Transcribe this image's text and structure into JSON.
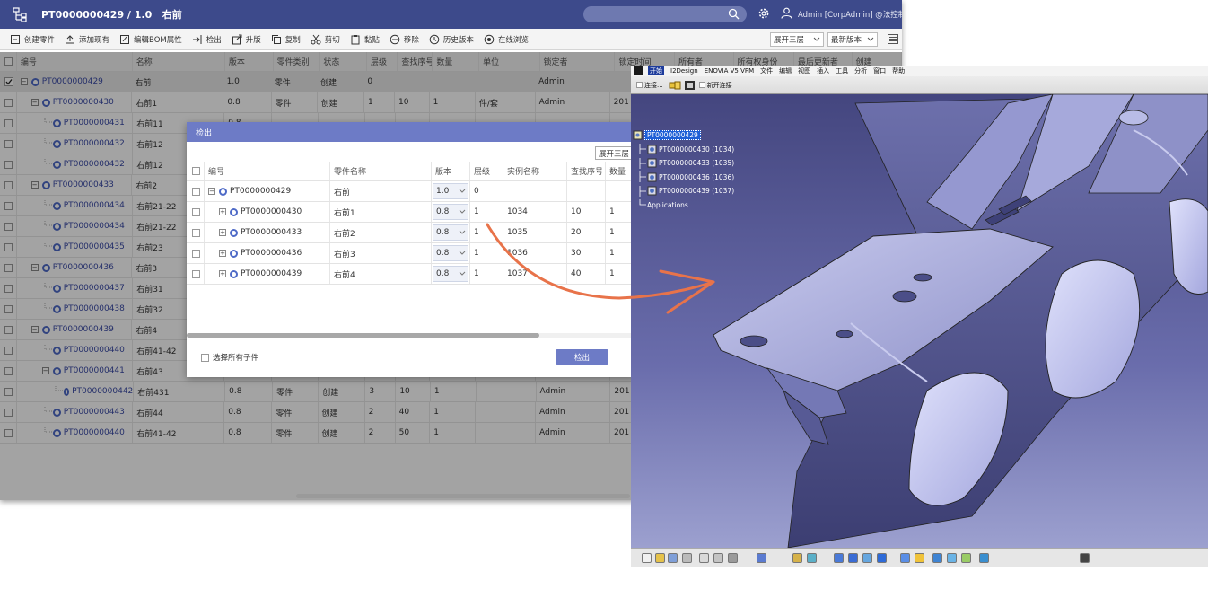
{
  "plm": {
    "title": "PT0000000429 / 1.0",
    "title_suffix": "右前",
    "user": "Admin [CorpAdmin] @法控制",
    "toolbar": [
      {
        "label": "创建零件",
        "icon": "create-part-icon"
      },
      {
        "label": "添加现有",
        "icon": "add-existing-icon"
      },
      {
        "label": "编辑BOM属性",
        "icon": "edit-bom-icon"
      },
      {
        "label": "检出",
        "icon": "checkout-icon"
      },
      {
        "label": "升版",
        "icon": "revise-icon"
      },
      {
        "label": "复制",
        "icon": "copy-icon"
      },
      {
        "label": "剪切",
        "icon": "cut-icon"
      },
      {
        "label": "黏贴",
        "icon": "paste-icon"
      },
      {
        "label": "移除",
        "icon": "remove-icon"
      },
      {
        "label": "历史版本",
        "icon": "history-icon"
      },
      {
        "label": "在线浏览",
        "icon": "online-view-icon"
      }
    ],
    "level_select": "展开三层",
    "version_select": "最新版本",
    "columns": [
      "编号",
      "名称",
      "版本",
      "零件类别",
      "状态",
      "层级",
      "查找序号",
      "数量",
      "单位",
      "锁定者",
      "锁定时间",
      "所有者",
      "所有权身份",
      "最后更新者",
      "创建"
    ],
    "rows": [
      {
        "code": "PT0000000429",
        "name": "右前",
        "version": "1.0",
        "category": "零件",
        "status": "创建",
        "level": "0",
        "find": "",
        "qty": "",
        "unit": "",
        "locker": "Admin",
        "locktime": "",
        "selected": true
      },
      {
        "code": "PT0000000430",
        "name": "右前1",
        "version": "0.8",
        "category": "零件",
        "status": "创建",
        "level": "1",
        "find": "10",
        "qty": "1",
        "unit": "件/套",
        "locker": "Admin",
        "locktime": "201"
      },
      {
        "code": "PT0000000431",
        "name": "右前11",
        "version": "0.8",
        "category": "",
        "status": "",
        "level": "",
        "find": "",
        "qty": "",
        "unit": "",
        "locker": "",
        "locktime": ""
      },
      {
        "code": "PT0000000432",
        "name": "右前12",
        "version": "",
        "category": "",
        "status": "",
        "level": "",
        "find": "",
        "qty": "",
        "unit": "",
        "locker": "",
        "locktime": ""
      },
      {
        "code": "PT0000000432",
        "name": "右前12",
        "version": "",
        "category": "",
        "status": "",
        "level": "",
        "find": "",
        "qty": "",
        "unit": "",
        "locker": "",
        "locktime": ""
      },
      {
        "code": "PT0000000433",
        "name": "右前2",
        "version": "",
        "category": "",
        "status": "",
        "level": "",
        "find": "",
        "qty": "",
        "unit": "",
        "locker": "",
        "locktime": ""
      },
      {
        "code": "PT0000000434",
        "name": "右前21-22",
        "version": "",
        "category": "",
        "status": "",
        "level": "",
        "find": "",
        "qty": "",
        "unit": "",
        "locker": "",
        "locktime": ""
      },
      {
        "code": "PT0000000434",
        "name": "右前21-22",
        "version": "",
        "category": "",
        "status": "",
        "level": "",
        "find": "",
        "qty": "",
        "unit": "",
        "locker": "",
        "locktime": ""
      },
      {
        "code": "PT0000000435",
        "name": "右前23",
        "version": "",
        "category": "",
        "status": "",
        "level": "",
        "find": "",
        "qty": "",
        "unit": "",
        "locker": "",
        "locktime": ""
      },
      {
        "code": "PT0000000436",
        "name": "右前3",
        "version": "",
        "category": "",
        "status": "",
        "level": "",
        "find": "",
        "qty": "",
        "unit": "",
        "locker": "",
        "locktime": ""
      },
      {
        "code": "PT0000000437",
        "name": "右前31",
        "version": "",
        "category": "",
        "status": "",
        "level": "",
        "find": "",
        "qty": "",
        "unit": "",
        "locker": "",
        "locktime": ""
      },
      {
        "code": "PT0000000438",
        "name": "右前32",
        "version": "",
        "category": "",
        "status": "",
        "level": "",
        "find": "",
        "qty": "",
        "unit": "",
        "locker": "",
        "locktime": ""
      },
      {
        "code": "PT0000000439",
        "name": "右前4",
        "version": "",
        "category": "",
        "status": "",
        "level": "",
        "find": "",
        "qty": "",
        "unit": "",
        "locker": "",
        "locktime": ""
      },
      {
        "code": "PT0000000440",
        "name": "右前41-42",
        "version": "",
        "category": "",
        "status": "",
        "level": "",
        "find": "",
        "qty": "",
        "unit": "",
        "locker": "",
        "locktime": ""
      },
      {
        "code": "PT0000000441",
        "name": "右前43",
        "version": "",
        "category": "",
        "status": "",
        "level": "",
        "find": "",
        "qty": "",
        "unit": "",
        "locker": "",
        "locktime": ""
      },
      {
        "code": "PT0000000442",
        "name": "右前431",
        "version": "0.8",
        "category": "零件",
        "status": "创建",
        "level": "3",
        "find": "10",
        "qty": "1",
        "unit": "",
        "locker": "Admin",
        "locktime": "201"
      },
      {
        "code": "PT0000000443",
        "name": "右前44",
        "version": "0.8",
        "category": "零件",
        "status": "创建",
        "level": "2",
        "find": "40",
        "qty": "1",
        "unit": "",
        "locker": "Admin",
        "locktime": "201"
      },
      {
        "code": "PT0000000440",
        "name": "右前41-42",
        "version": "0.8",
        "category": "零件",
        "status": "创建",
        "level": "2",
        "find": "50",
        "qty": "1",
        "unit": "",
        "locker": "Admin",
        "locktime": "201"
      }
    ]
  },
  "dialog": {
    "title": "检出",
    "expand_label": "展开三层",
    "columns": [
      "编号",
      "零件名称",
      "版本",
      "层级",
      "实例名称",
      "查找序号",
      "数量"
    ],
    "rows": [
      {
        "code": "PT0000000429",
        "name": "右前",
        "version": "1.0",
        "level": "0",
        "instance": "",
        "find": "",
        "qty": ""
      },
      {
        "code": "PT0000000430",
        "name": "右前1",
        "version": "0.8",
        "level": "1",
        "instance": "1034",
        "find": "10",
        "qty": "1"
      },
      {
        "code": "PT0000000433",
        "name": "右前2",
        "version": "0.8",
        "level": "1",
        "instance": "1035",
        "find": "20",
        "qty": "1"
      },
      {
        "code": "PT0000000436",
        "name": "右前3",
        "version": "0.8",
        "level": "1",
        "instance": "1036",
        "find": "30",
        "qty": "1"
      },
      {
        "code": "PT0000000439",
        "name": "右前4",
        "version": "0.8",
        "level": "1",
        "instance": "1037",
        "find": "40",
        "qty": "1"
      }
    ],
    "select_all_label": "选择所有子件",
    "checkout_button": "检出"
  },
  "catia": {
    "menu": [
      "开始",
      "I2Design",
      "ENOVIA V5 VPM",
      "文件",
      "编辑",
      "视图",
      "插入",
      "工具",
      "分析",
      "窗口",
      "帮助"
    ],
    "toolbar_connect": "连接...",
    "toolbar_new_connect": "新开连接",
    "tree_root": "PT0000000429",
    "tree_children": [
      "PT0000000430 (1034)",
      "PT0000000433 (1035)",
      "PT0000000436 (1036)",
      "PT0000000439 (1037)"
    ],
    "tree_applications": "Applications"
  },
  "colors": {
    "header": "#3d4a8b",
    "accent": "#6d7bc6",
    "link": "#3a4aa6",
    "arrow": "#e8734a"
  }
}
